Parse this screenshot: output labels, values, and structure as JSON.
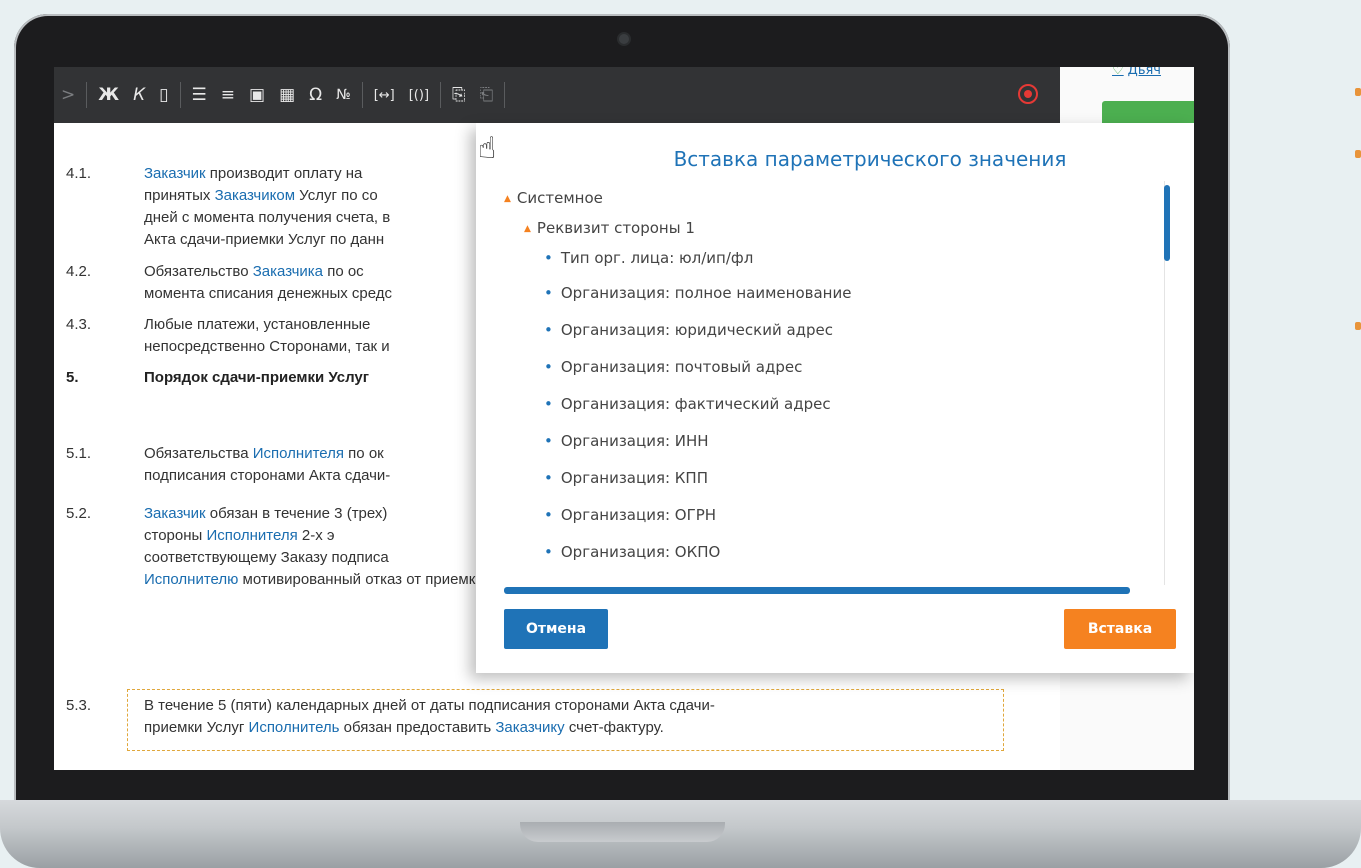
{
  "toolbar": {
    "more": ">",
    "bold": "Ж",
    "italic": "К",
    "block": "▯",
    "list_numbered": "☰",
    "list_bulleted": "≡",
    "image": "▣",
    "table": "▦",
    "omega": "Ω",
    "number": "№",
    "param": "[↔]",
    "param_block": "[()]",
    "paste": "⎘",
    "paste_plain": "⎗",
    "close_color": "#e53935"
  },
  "user": {
    "name": "Дьяч"
  },
  "doc": {
    "rows": [
      {
        "num": "4.1.",
        "lines": [
          [
            "Заказчик",
            " производит оплату на"
          ],
          [
            "принятых ",
            "Заказчиком",
            " Услуг по со"
          ],
          [
            "дней с момента получения счета, в"
          ],
          [
            "Акта сдачи-приемки Услуг по данн"
          ]
        ]
      },
      {
        "num": "4.2.",
        "l1a": "Обязательство ",
        "l1b": "Заказчика",
        "l1c": " по ос",
        "l2": "момента списания денежных средс"
      },
      {
        "num": "4.3.",
        "l1": "Любые платежи, установленные",
        "l2": "непосредственно Сторонами, так и"
      },
      {
        "num": "5.",
        "l1": "Порядок сдачи-приемки Услуг"
      },
      {
        "num": "5.1.",
        "l1a": "Обязательства ",
        "l1b": "Исполнителя",
        "l1c": " по ок",
        "l2": "подписания сторонами Акта сдачи-"
      },
      {
        "num": "5.2.",
        "l1a": "Заказчик",
        "l1b": " обязан в течение 3 (трех)",
        "l2a": "стороны   ",
        "l2b": "Исполнителя",
        "l2c": "   2-х   э",
        "l3": "соответствующему Заказу подписа",
        "l4a": "Исполнителю",
        "l4b": " мотивированный отказ от приемки Услуг."
      },
      {
        "num": "5.3.",
        "l1": "В течение 5 (пяти) календарных дней от даты подписания сторонами Акта сдачи-",
        "l2a": "приемки Услуг ",
        "l2b": "Исполнитель",
        "l2c": " обязан предоставить ",
        "l2d": "Заказчику",
        "l2e": " счет-фактуру."
      }
    ]
  },
  "dialog": {
    "title": "Вставка параметрического значения",
    "tree": {
      "root": "Системное",
      "group": "Реквизит стороны 1",
      "items": [
        "Тип орг. лица: юл/ип/фл",
        "Организация: полное наименование",
        "Организация: юридический адрес",
        "Организация: почтовый адрес",
        "Организация: фактический адрес",
        "Организация: ИНН",
        "Организация: КПП",
        "Организация: ОГРН",
        "Организация: ОКПО"
      ]
    },
    "cancel": "Отмена",
    "insert": "Вставка",
    "accent": "#1f73b7",
    "orange": "#f58220"
  }
}
